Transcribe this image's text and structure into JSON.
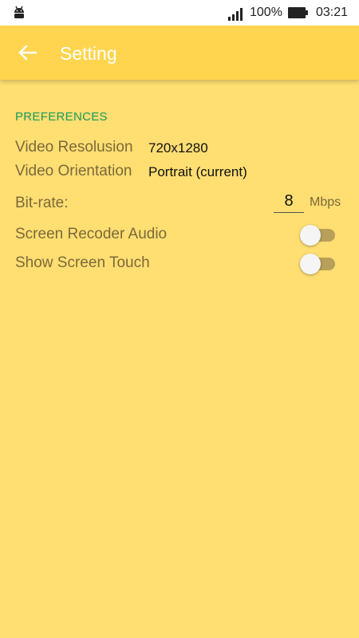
{
  "status_bar": {
    "battery_percent": "100%",
    "time": "03:21",
    "icons": [
      "android-icon",
      "signal-icon",
      "battery-icon"
    ]
  },
  "app_bar": {
    "title": "Setting",
    "back_icon": "arrow-left-icon"
  },
  "preferences": {
    "header": "PREFERENCES",
    "video_resolution": {
      "label": "Video Resolusion",
      "value": "720x1280"
    },
    "video_orientation": {
      "label": "Video Orientation",
      "value": "Portrait (current)"
    },
    "bitrate": {
      "label": "Bit-rate:",
      "value": "8",
      "unit": "Mbps"
    },
    "screen_recorder_audio": {
      "label": "Screen Recoder Audio",
      "enabled": false
    },
    "show_screen_touch": {
      "label": "Show Screen Touch",
      "enabled": false
    }
  },
  "colors": {
    "background": "#FFDE72",
    "app_bar": "#FFD54F",
    "section_header": "#1B9A59",
    "label_text": "#7A6A3A"
  }
}
